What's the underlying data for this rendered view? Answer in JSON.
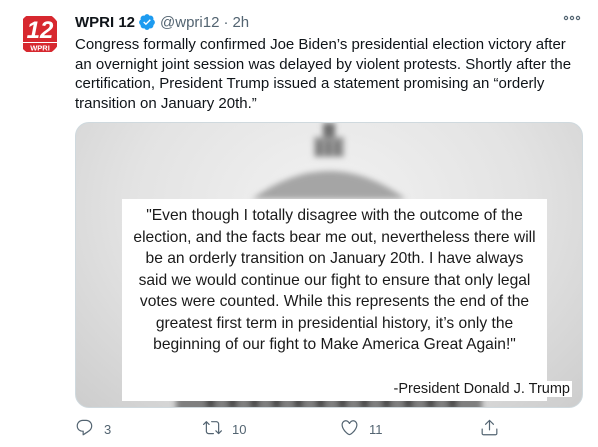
{
  "tweet": {
    "author": {
      "display_name": "WPRI 12",
      "handle": "@wpri12",
      "avatar_text_top": "12",
      "avatar_text_bottom": "WPRI",
      "verified": true
    },
    "separator": "·",
    "timestamp": "2h",
    "text": "Congress formally confirmed Joe Biden’s presidential election victory after an overnight joint session was delayed by violent protests. Shortly after the certification, President Trump issued a statement promising an “orderly transition on January 20th.”",
    "media": {
      "quote": "\"Even though I totally disagree with the outcome of the election, and the facts bear me out, nevertheless there will be an orderly transition on January 20th. I have always said we would continue our fight to ensure that only legal votes were counted. While this represents the end of the greatest first term in presidential history, it’s only the beginning of our fight to Make America Great Again!\"",
      "attribution": "-President Donald J. Trump"
    },
    "actions": {
      "reply_count": "3",
      "retweet_count": "10",
      "like_count": "11"
    }
  },
  "colors": {
    "text": "#0f1419",
    "secondary": "#536471",
    "verified": "#1d9bf0",
    "brand_red": "#d7282f"
  },
  "icons": [
    "more-icon",
    "verified-icon",
    "reply-icon",
    "retweet-icon",
    "like-icon",
    "share-icon"
  ]
}
